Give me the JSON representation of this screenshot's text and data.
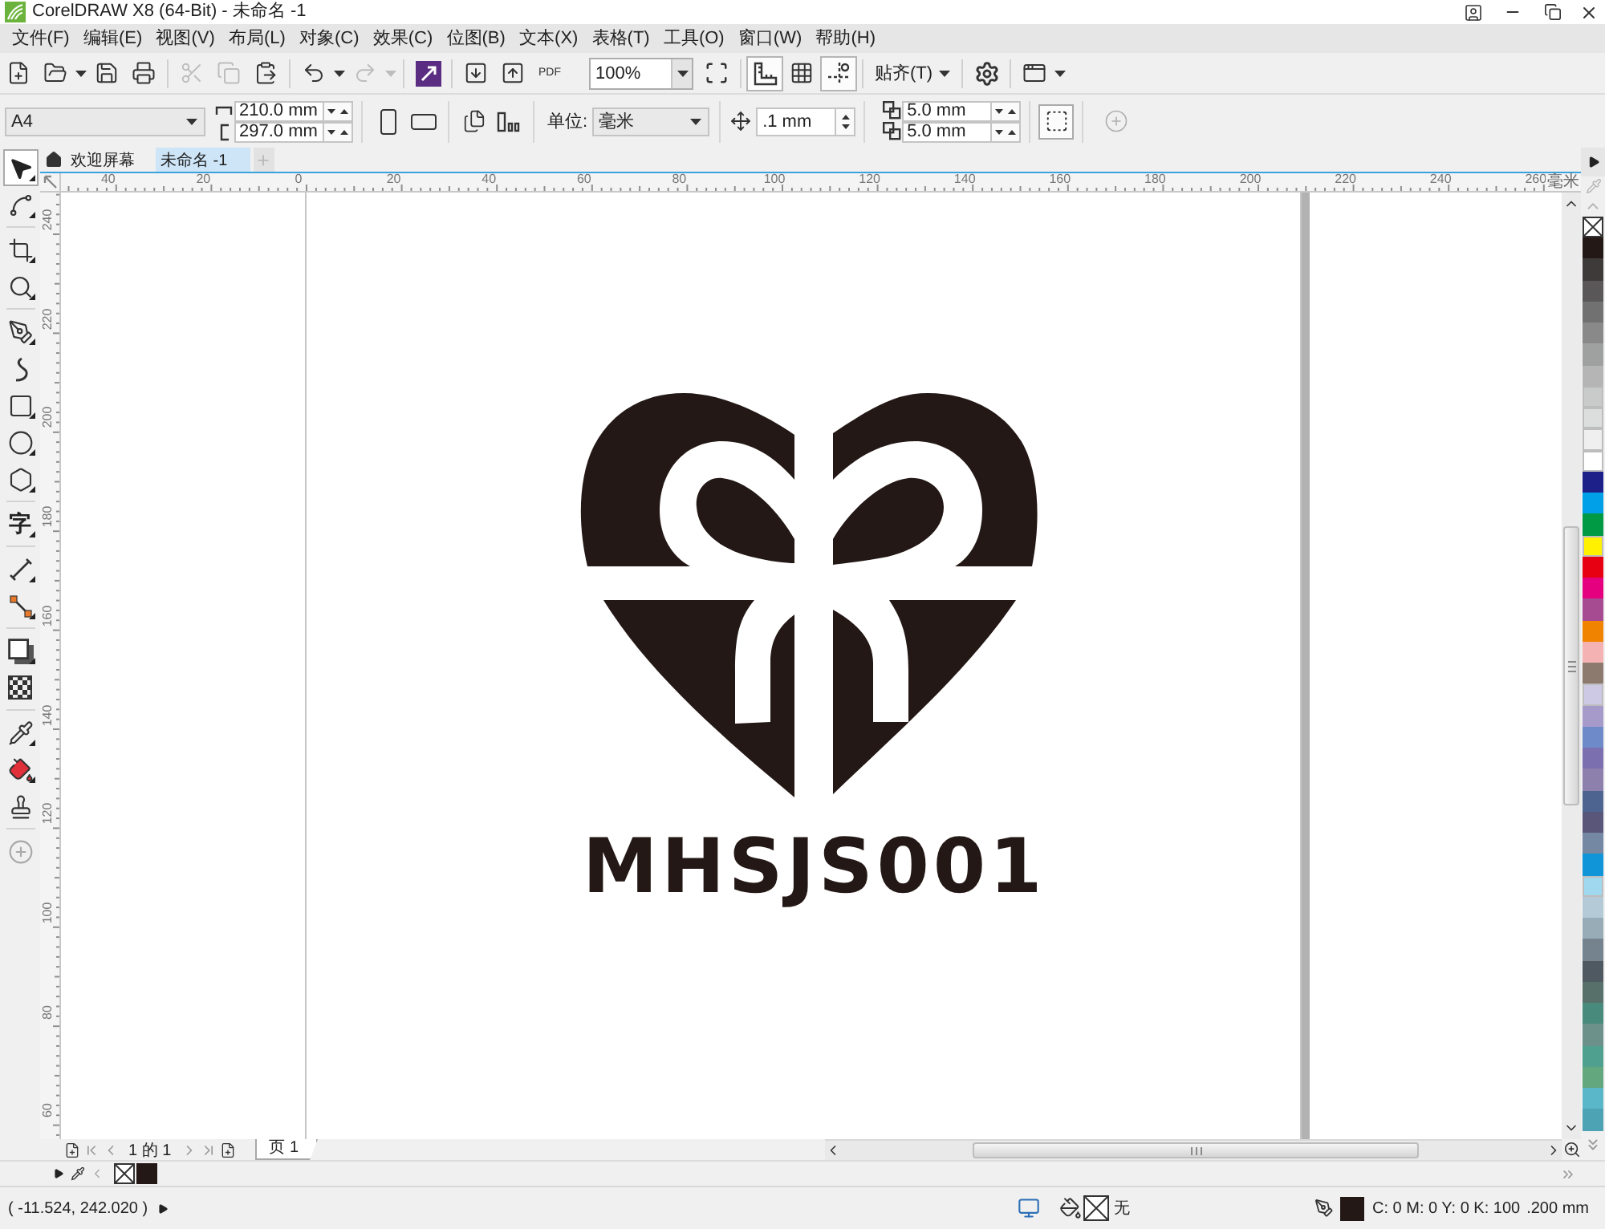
{
  "window": {
    "title": "CorelDRAW X8 (64-Bit) - 未命名 -1"
  },
  "menu": [
    "文件(F)",
    "编辑(E)",
    "视图(V)",
    "布局(L)",
    "对象(C)",
    "效果(C)",
    "位图(B)",
    "文本(X)",
    "表格(T)",
    "工具(O)",
    "窗口(W)",
    "帮助(H)"
  ],
  "toolbar": {
    "clipboard": [
      {
        "kind": "cut",
        "disabled": true
      },
      {
        "kind": "copy",
        "disabled": true
      },
      {
        "kind": "paste",
        "disabled": false
      }
    ],
    "history": [
      {
        "kind": "undo",
        "disabled": false
      },
      {
        "kind": "redo",
        "disabled": true
      }
    ],
    "pdf_label": "PDF",
    "zoom": "100%",
    "toggles": [
      {
        "kind": "rulers",
        "on": true
      },
      {
        "kind": "grid",
        "on": false
      },
      {
        "kind": "guides",
        "on": true
      }
    ],
    "snap": "贴齐(T)"
  },
  "property_bar": {
    "page_size": "A4",
    "width": "210.0 mm",
    "height": "297.0 mm",
    "units_label": "单位:",
    "units": "毫米",
    "nudge": ".1 mm",
    "duplicate_x": "5.0 mm",
    "duplicate_y": "5.0 mm"
  },
  "document_tabs": [
    {
      "kind": "home",
      "label": "欢迎屏幕",
      "selected": false
    },
    {
      "kind": "document",
      "label": "未命名 -1",
      "selected": true
    }
  ],
  "toolbox": {
    "groups": [
      {
        "tools": [
          {
            "kind": "pick",
            "selected": true,
            "flyout": true
          },
          {
            "kind": "shape",
            "selected": false,
            "flyout": true
          }
        ]
      },
      {
        "tools": [
          {
            "kind": "crop",
            "selected": false,
            "flyout": true
          },
          {
            "kind": "zoom",
            "selected": false,
            "flyout": true
          }
        ]
      },
      {
        "tools": [
          {
            "kind": "freehand",
            "selected": false,
            "flyout": true
          },
          {
            "kind": "artistic_media",
            "selected": false,
            "flyout": false
          },
          {
            "kind": "rectangle",
            "selected": false,
            "flyout": true
          },
          {
            "kind": "ellipse",
            "selected": false,
            "flyout": true
          },
          {
            "kind": "polygon",
            "selected": false,
            "flyout": true
          }
        ]
      },
      {
        "tools": [
          {
            "kind": "text",
            "label": "字",
            "selected": false,
            "flyout": true
          }
        ]
      },
      {
        "tools": [
          {
            "kind": "dimension",
            "selected": false,
            "flyout": true
          },
          {
            "kind": "connector",
            "selected": false,
            "flyout": true
          }
        ]
      },
      {
        "tools": [
          {
            "kind": "shadow",
            "selected": false,
            "flyout": true
          },
          {
            "kind": "transparency",
            "selected": false,
            "flyout": false
          }
        ]
      },
      {
        "tools": [
          {
            "kind": "eyedropper",
            "selected": false,
            "flyout": true
          },
          {
            "kind": "interactive_fill",
            "selected": false,
            "flyout": true
          },
          {
            "kind": "smart_fill",
            "selected": false,
            "flyout": false
          }
        ]
      },
      {
        "tools": [
          {
            "kind": "customize",
            "selected": false,
            "flyout": false
          }
        ]
      }
    ]
  },
  "rulers": {
    "horizontal": [
      "40",
      "20",
      "0",
      "20",
      "40",
      "60",
      "80",
      "100",
      "120",
      "140",
      "160",
      "180",
      "200",
      "220",
      "240",
      "260"
    ],
    "unit": "毫米",
    "vertical": [
      "240",
      "220",
      "200",
      "180",
      "160",
      "140",
      "120",
      "100",
      "80",
      "60"
    ]
  },
  "canvas": {
    "logo_text": "MHSJS001"
  },
  "page_navigation": {
    "count": "1 的 1",
    "pages": [
      {
        "label": "页 1",
        "selected": true
      }
    ]
  },
  "palette": {
    "colors": [
      {
        "color": "#231815"
      },
      {
        "color": "#3e3a39"
      },
      {
        "color": "#595757"
      },
      {
        "color": "#727171"
      },
      {
        "color": "#898989"
      },
      {
        "color": "#9fa0a0"
      },
      {
        "color": "#b5b5b6"
      },
      {
        "color": "#c9caca"
      },
      {
        "color": "#dcdddd"
      },
      {
        "color": "#efefef"
      },
      {
        "color": "#ffffff"
      },
      {
        "color": "#1d2088"
      },
      {
        "color": "#00a0e9"
      },
      {
        "color": "#009944"
      },
      {
        "color": "#fff100"
      },
      {
        "color": "#e60012"
      },
      {
        "color": "#e4007f"
      },
      {
        "color": "#a64a92"
      },
      {
        "color": "#f08300"
      },
      {
        "color": "#f5b2b2"
      },
      {
        "color": "#8c7a6f"
      },
      {
        "color": "#cdc8e4"
      },
      {
        "color": "#a59aca"
      },
      {
        "color": "#6f8ac8"
      },
      {
        "color": "#7c6fb0"
      },
      {
        "color": "#8d80ac"
      },
      {
        "color": "#4d6491"
      },
      {
        "color": "#59567a"
      },
      {
        "color": "#7487a3"
      },
      {
        "color": "#0f95d8"
      },
      {
        "color": "#a0d8ef"
      },
      {
        "color": "#b4cad6"
      },
      {
        "color": "#98acb8"
      },
      {
        "color": "#74838e"
      },
      {
        "color": "#4e5961"
      },
      {
        "color": "#577069"
      },
      {
        "color": "#488a7b"
      },
      {
        "color": "#6c918b"
      },
      {
        "color": "#4fa08f"
      },
      {
        "color": "#62a77d"
      },
      {
        "color": "#5ab7ca"
      },
      {
        "color": "#4da2b4"
      }
    ]
  },
  "document_palette": {
    "colors": [
      {
        "color": "#231815"
      }
    ]
  },
  "status_bar": {
    "coordinates": "( -11.524, 242.020 )",
    "fill": "无",
    "outline": {
      "color": "#231815",
      "values": "C: 0 M: 0 Y: 0 K: 100",
      "width": ".200 mm"
    }
  }
}
